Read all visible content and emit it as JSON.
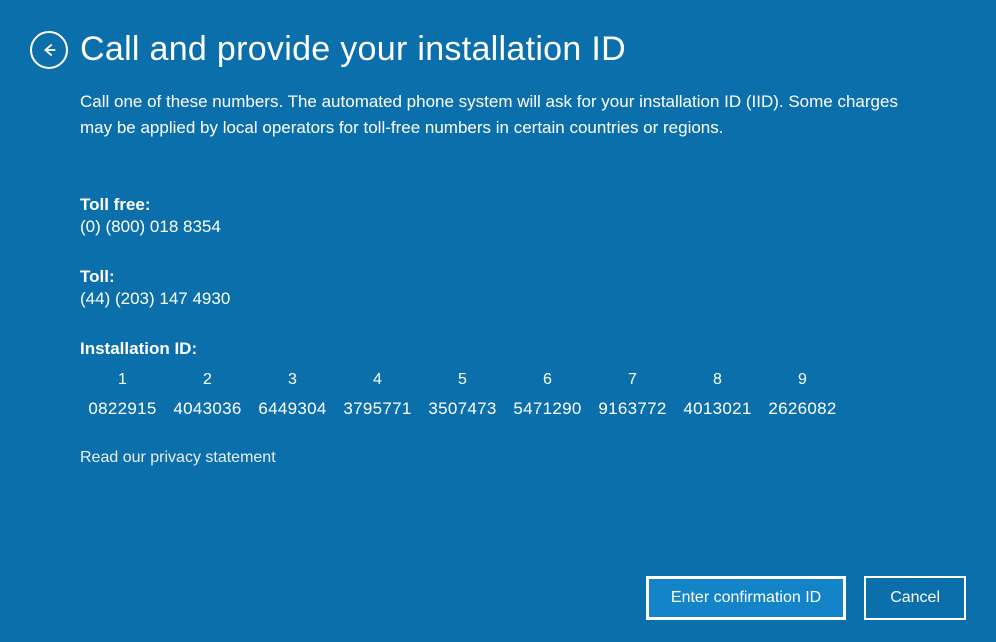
{
  "header": {
    "title": "Call and provide your installation ID"
  },
  "instruction": "Call one of these numbers. The automated phone system will ask for your installation ID (IID). Some charges may be applied by local operators for toll-free numbers in certain countries or regions.",
  "phones": {
    "toll_free_label": "Toll free:",
    "toll_free_number": "(0) (800) 018 8354",
    "toll_label": "Toll:",
    "toll_number": "(44) (203) 147 4930"
  },
  "installation": {
    "label": "Installation ID:",
    "columns": [
      {
        "header": "1",
        "value": "0822915"
      },
      {
        "header": "2",
        "value": "4043036"
      },
      {
        "header": "3",
        "value": "6449304"
      },
      {
        "header": "4",
        "value": "3795771"
      },
      {
        "header": "5",
        "value": "3507473"
      },
      {
        "header": "6",
        "value": "5471290"
      },
      {
        "header": "7",
        "value": "9163772"
      },
      {
        "header": "8",
        "value": "4013021"
      },
      {
        "header": "9",
        "value": "2626082"
      }
    ]
  },
  "privacy_link": "Read our privacy statement",
  "buttons": {
    "confirm": "Enter confirmation ID",
    "cancel": "Cancel"
  }
}
